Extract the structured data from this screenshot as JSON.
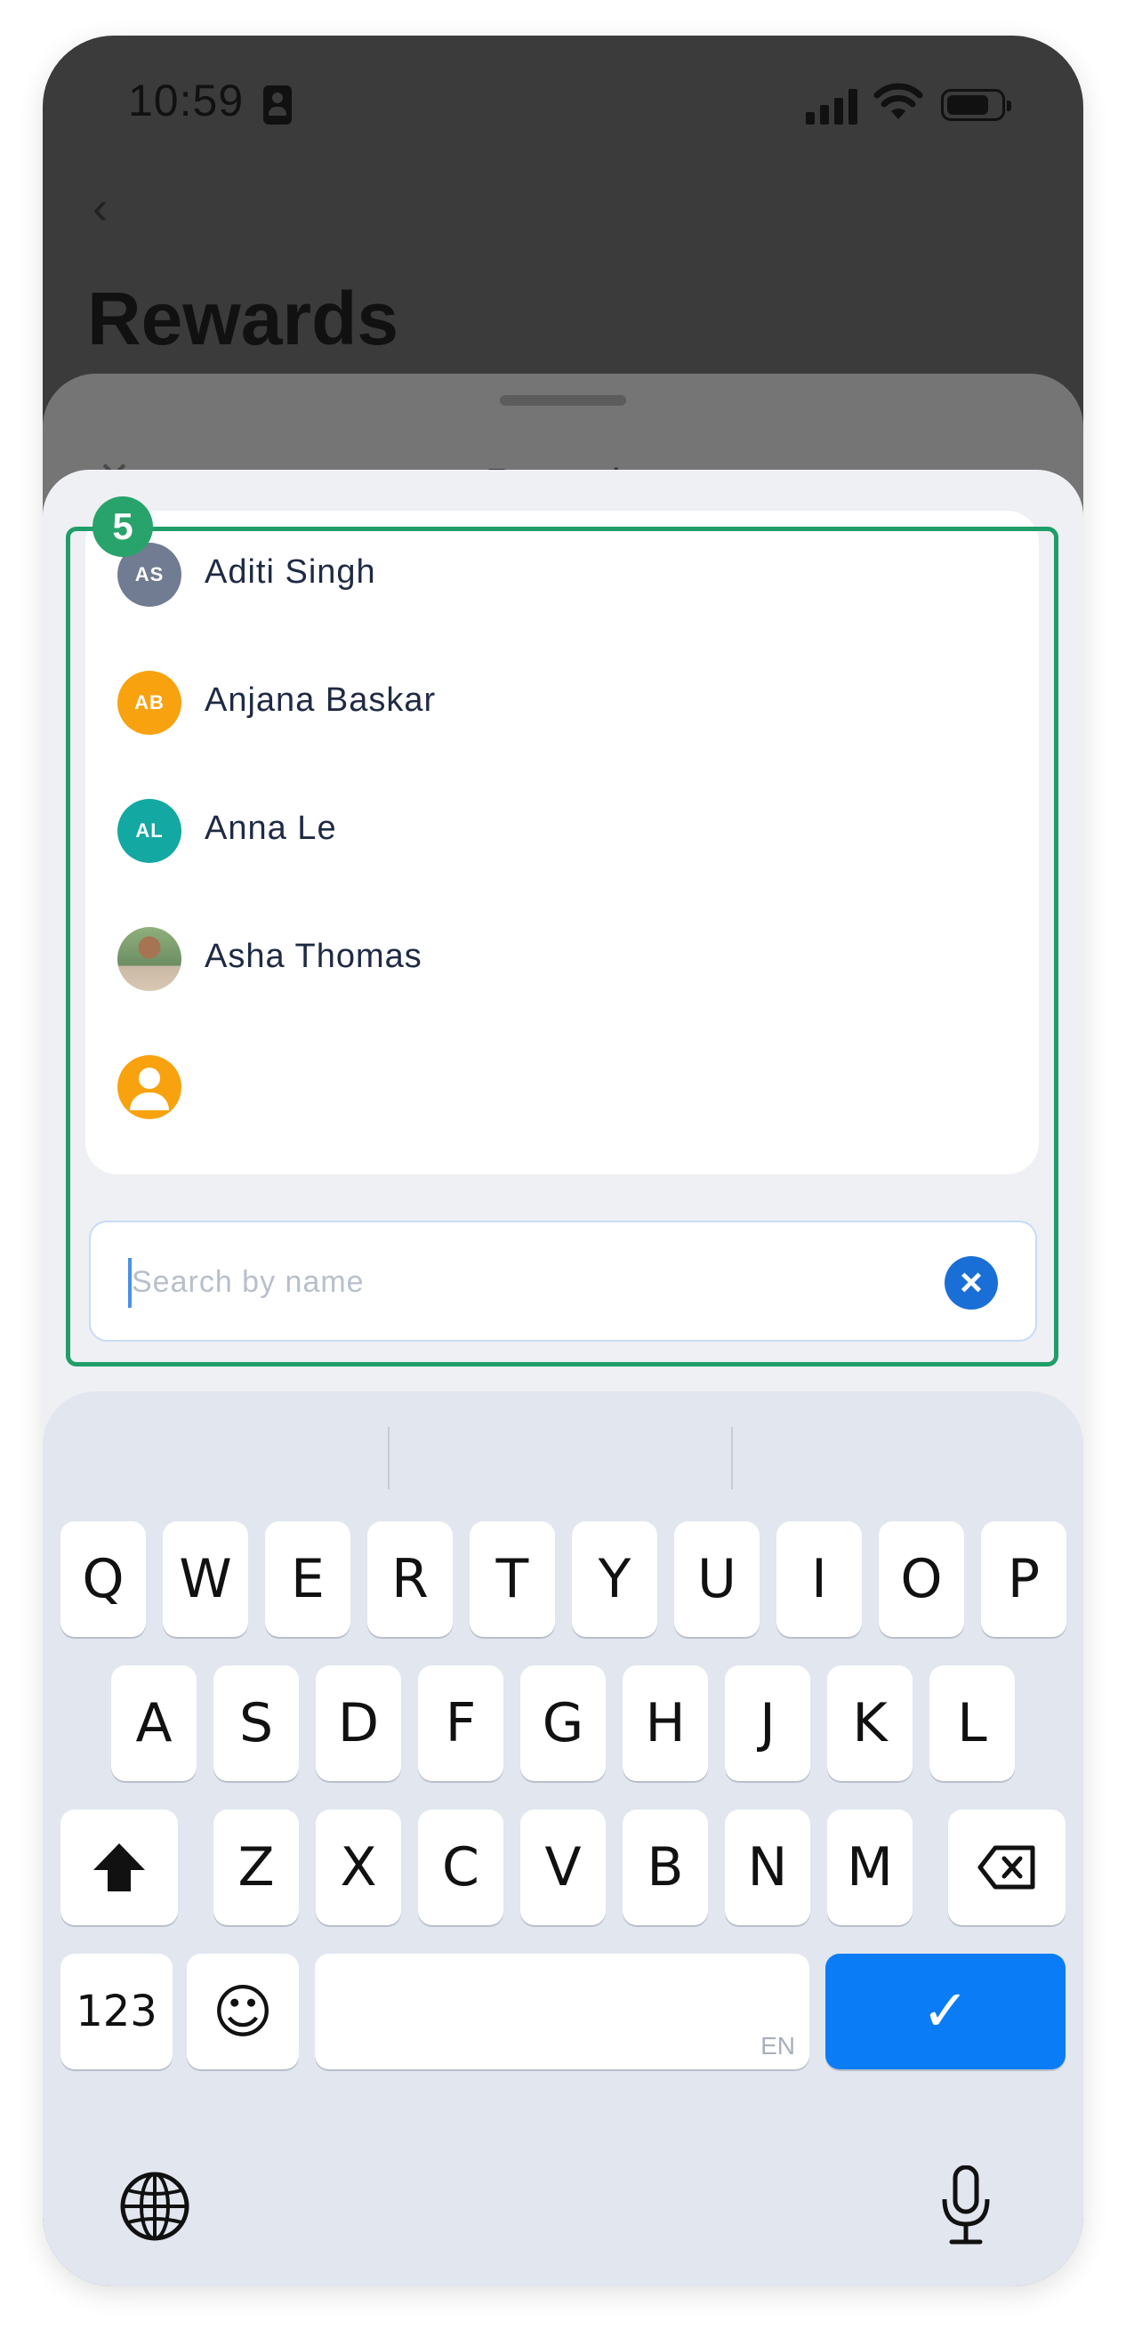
{
  "status_bar": {
    "time": "10:59"
  },
  "header": {
    "back_icon": "chevron-left-icon",
    "title": "Rewards"
  },
  "background_sheet": {
    "close_icon": "close-icon",
    "title": "Reward"
  },
  "contacts": [
    {
      "initials": "AS",
      "name": "Aditi Singh",
      "avatar_color": "#717c92",
      "avatar_type": "initials"
    },
    {
      "initials": "AB",
      "name": "Anjana Baskar",
      "avatar_color": "#f8a20f",
      "avatar_type": "initials"
    },
    {
      "initials": "AL",
      "name": "Anna Le",
      "avatar_color": "#13a8a2",
      "avatar_type": "initials"
    },
    {
      "initials": "",
      "name": "Asha Thomas",
      "avatar_color": "",
      "avatar_type": "photo"
    },
    {
      "initials": "",
      "name": "",
      "avatar_color": "#f8a20f",
      "avatar_type": "person-icon"
    }
  ],
  "search": {
    "placeholder": "Search by name",
    "value": "",
    "clear_icon": "clear-icon"
  },
  "keyboard": {
    "row1": [
      "Q",
      "W",
      "E",
      "R",
      "T",
      "Y",
      "U",
      "I",
      "O",
      "P"
    ],
    "row2": [
      "A",
      "S",
      "D",
      "F",
      "G",
      "H",
      "J",
      "K",
      "L"
    ],
    "row3": [
      "Z",
      "X",
      "C",
      "V",
      "B",
      "N",
      "M"
    ],
    "numbers_label": "123",
    "emoji": "☺",
    "space_lang": "EN",
    "done": "✓",
    "shift_icon": "shift-icon",
    "backspace_icon": "backspace-icon",
    "globe_icon": "globe-icon",
    "mic_icon": "microphone-icon"
  },
  "annotation": {
    "step_number": "5",
    "color": "#1f9e6a"
  }
}
